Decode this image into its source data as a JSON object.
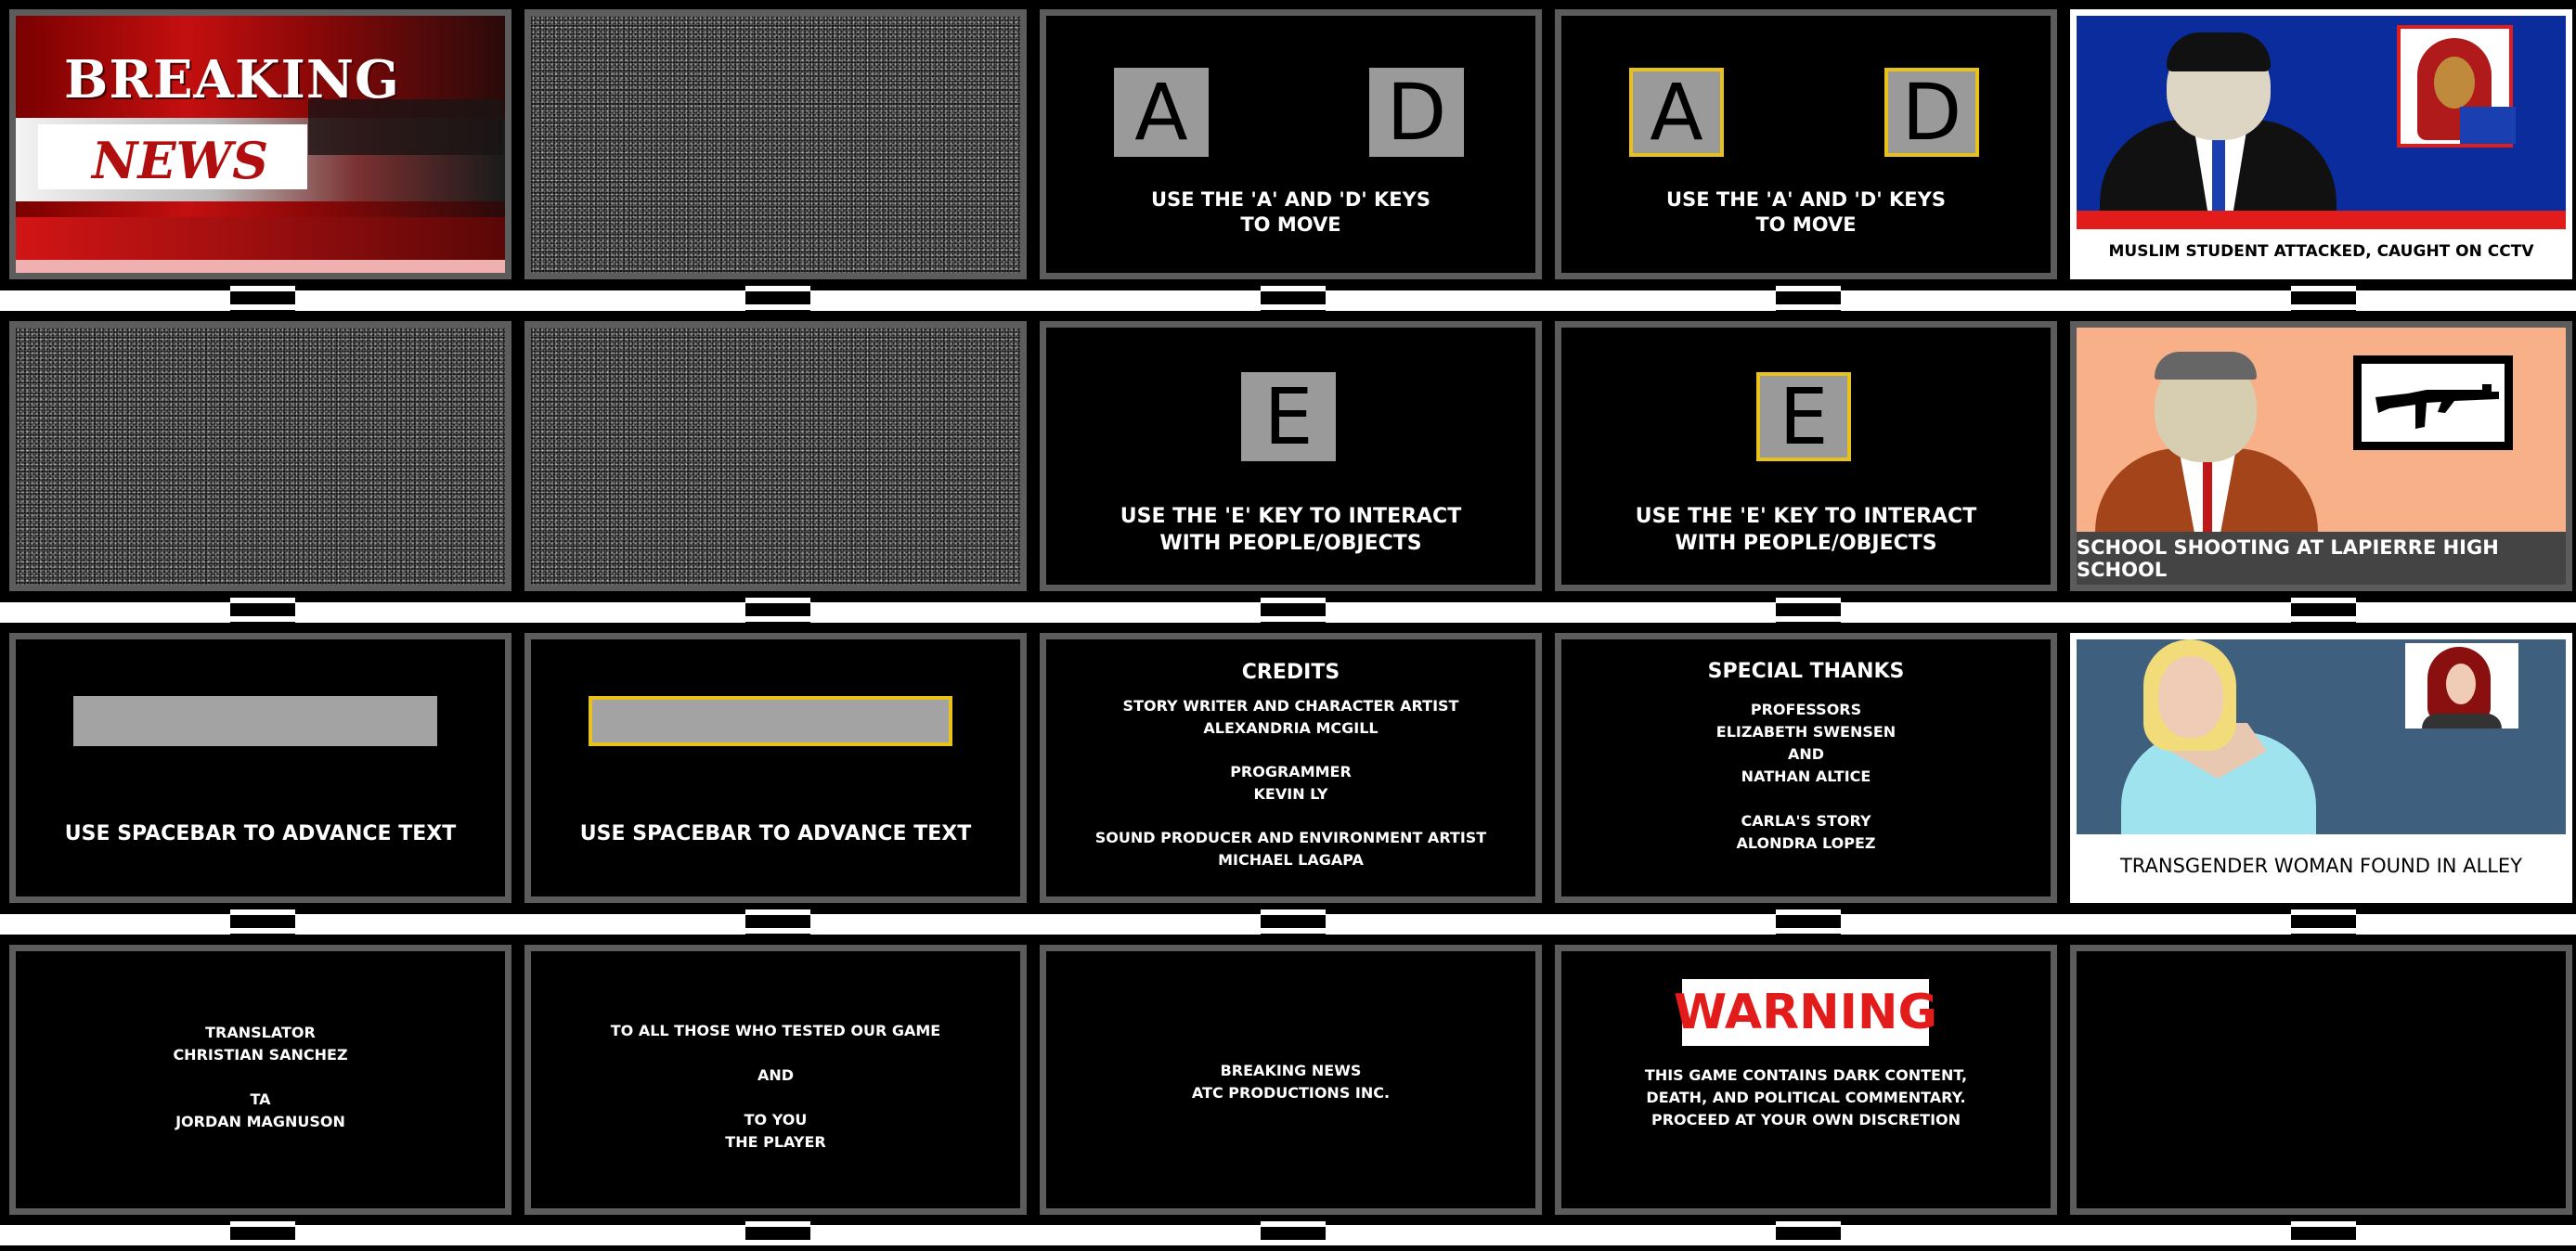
{
  "colors": {
    "border": "#5c5c5c",
    "key_grey": "#9a9a9a",
    "highlight": "#e8c21a",
    "news_red": "#e21b1b",
    "news_blue": "#0b2c9c",
    "warning_red": "#e21b1b",
    "peach": "#f8b088",
    "slate_blue": "#3f5f7f"
  },
  "tiles": {
    "r1c1": {
      "breaking": "BREAKING",
      "news": "NEWS"
    },
    "r1c3": {
      "key_a": "A",
      "key_d": "D",
      "caption": "USE THE 'A' AND 'D' KEYS\nTO MOVE"
    },
    "r1c4": {
      "key_a": "A",
      "key_d": "D",
      "caption": "USE THE 'A' AND 'D' KEYS\nTO MOVE"
    },
    "r1c5": {
      "headline": "MUSLIM STUDENT ATTACKED, CAUGHT ON CCTV"
    },
    "r2c3": {
      "key_e": "E",
      "caption": "USE THE 'E' KEY TO INTERACT\nWITH PEOPLE/OBJECTS"
    },
    "r2c4": {
      "key_e": "E",
      "caption": "USE THE 'E' KEY TO INTERACT\nWITH PEOPLE/OBJECTS"
    },
    "r2c5": {
      "headline": "SCHOOL SHOOTING AT LAPIERRE HIGH SCHOOL"
    },
    "r3c1": {
      "caption": "USE SPACEBAR TO ADVANCE TEXT"
    },
    "r3c2": {
      "caption": "USE SPACEBAR TO ADVANCE TEXT"
    },
    "r3c3": {
      "title": "CREDITS",
      "body": "STORY WRITER AND CHARACTER ARTIST\nALEXANDRIA MCGILL\n\nPROGRAMMER\nKEVIN LY\n\nSOUND PRODUCER AND ENVIRONMENT ARTIST\nMICHAEL LAGAPA"
    },
    "r3c4": {
      "title": "SPECIAL THANKS",
      "body": "PROFESSORS\nELIZABETH SWENSEN\nAND\nNATHAN ALTICE\n\nCARLA'S STORY\nALONDRA LOPEZ"
    },
    "r3c5": {
      "headline": "TRANSGENDER WOMAN FOUND IN ALLEY"
    },
    "r4c1": {
      "body": "TRANSLATOR\nCHRISTIAN SANCHEZ\n\nTA\nJORDAN MAGNUSON"
    },
    "r4c2": {
      "body": "TO ALL THOSE WHO TESTED OUR GAME\n\nAND\n\nTO YOU\nTHE PLAYER"
    },
    "r4c3": {
      "body": "BREAKING NEWS\nATC PRODUCTIONS INC."
    },
    "r4c4": {
      "warning": "WARNING",
      "body": "THIS GAME CONTAINS DARK CONTENT,\nDEATH, AND POLITICAL COMMENTARY.\nPROCEED AT YOUR OWN DISCRETION"
    }
  }
}
